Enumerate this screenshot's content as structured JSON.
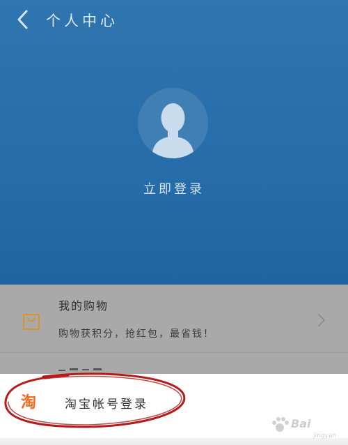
{
  "header": {
    "title": "个人中心",
    "back_icon": "chevron-left-icon"
  },
  "profile": {
    "avatar_icon": "user-avatar-icon",
    "login_label": "立即登录"
  },
  "shopping": {
    "title": "我的购物",
    "subtitle": "购物获积分，抢红包，最省钱！",
    "icon": "shopping-bag-icon",
    "chevron": "chevron-right-icon"
  },
  "taobao": {
    "icon_text": "淘",
    "label": "淘宝帐号登录"
  },
  "watermark": {
    "text": "Bai",
    "sub": "jingyan"
  },
  "colors": {
    "header_blue": "#2a6fab",
    "dim_panel": "#a9a9a9",
    "shop_icon_orange": "#d9952a",
    "taobao_orange": "#f06a1f",
    "annotation_red": "#b41c1c"
  }
}
